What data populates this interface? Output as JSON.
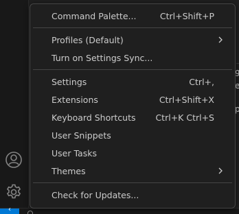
{
  "menu": {
    "groups": [
      {
        "items": [
          {
            "label": "Command Palette...",
            "shortcut": "Ctrl+Shift+P"
          }
        ]
      },
      {
        "items": [
          {
            "label": "Profiles (Default)",
            "shortcut": "",
            "submenu": true
          },
          {
            "label": "Turn on Settings Sync...",
            "shortcut": ""
          }
        ]
      },
      {
        "items": [
          {
            "label": "Settings",
            "shortcut": "Ctrl+,"
          },
          {
            "label": "Extensions",
            "shortcut": "Ctrl+Shift+X"
          },
          {
            "label": "Keyboard Shortcuts",
            "shortcut": "Ctrl+K Ctrl+S"
          },
          {
            "label": "User Snippets",
            "shortcut": ""
          },
          {
            "label": "User Tasks",
            "shortcut": ""
          },
          {
            "label": "Themes",
            "shortcut": "",
            "submenu": true
          }
        ]
      },
      {
        "items": [
          {
            "label": "Check for Updates...",
            "shortcut": ""
          }
        ]
      }
    ]
  },
  "activity_bar": {
    "icons": [
      "account-icon",
      "manage-gear-icon"
    ]
  },
  "editor_peek": {
    "chars": [
      "9",
      "e",
      "p"
    ]
  },
  "status_bar": {
    "remote_icon": "remote-icon"
  },
  "colors": {
    "menu_background": "#1f1f1f",
    "menu_border": "#454545",
    "text": "#cccccc",
    "accent": "#0078d4"
  }
}
